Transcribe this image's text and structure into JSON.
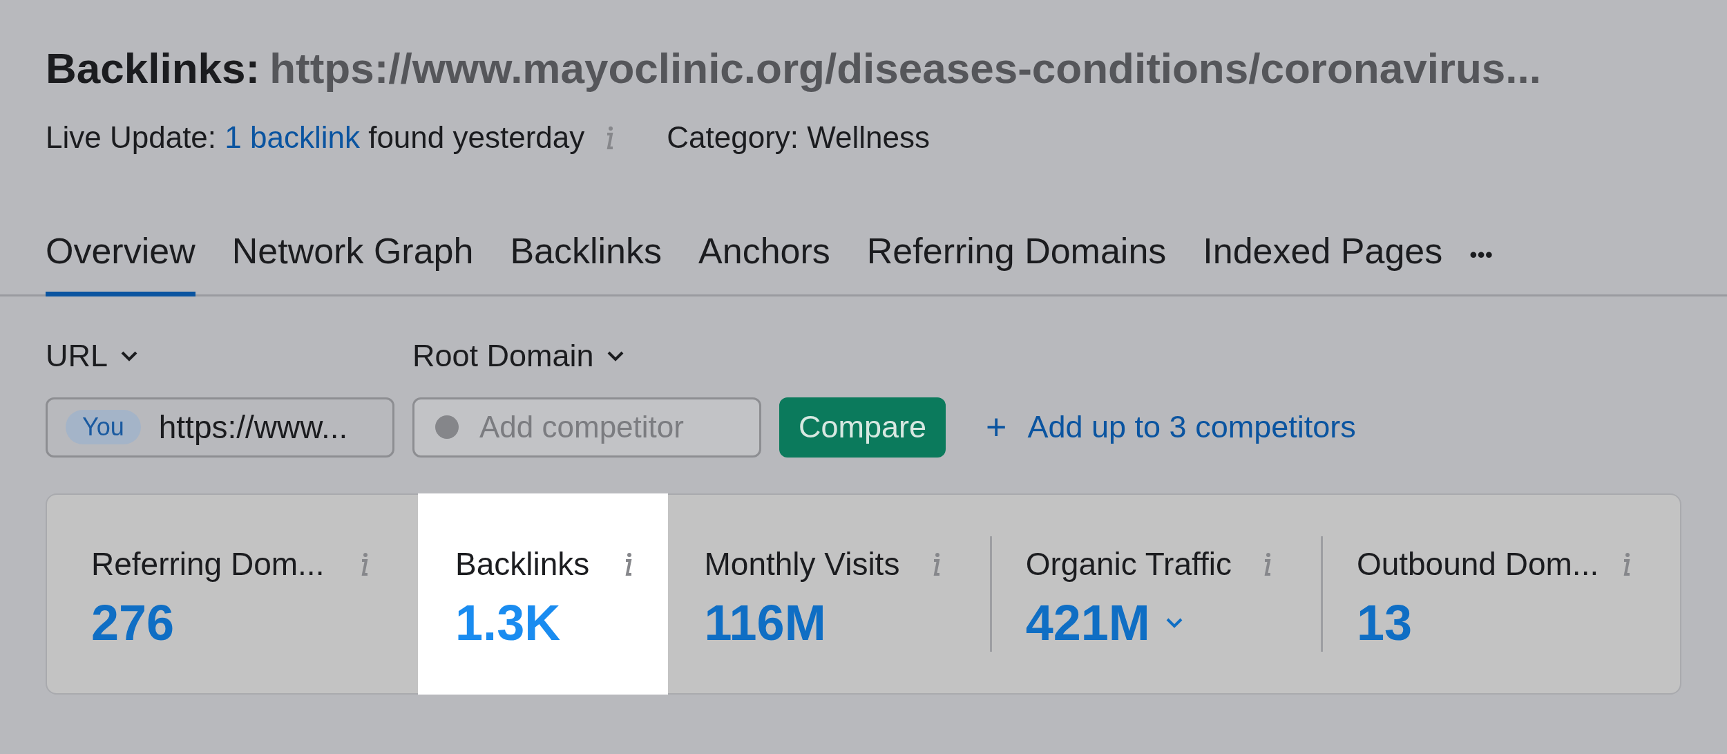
{
  "header": {
    "title_label": "Backlinks:",
    "title_url": "https://www.mayoclinic.org/diseases-conditions/coronavirus...",
    "live_update": {
      "prefix": "Live Update:",
      "link": "1 backlink",
      "suffix": "found yesterday"
    },
    "category": "Category: Wellness"
  },
  "tabs": [
    {
      "label": "Overview",
      "selected": true
    },
    {
      "label": "Network Graph",
      "selected": false
    },
    {
      "label": "Backlinks",
      "selected": false
    },
    {
      "label": "Anchors",
      "selected": false
    },
    {
      "label": "Referring Domains",
      "selected": false
    },
    {
      "label": "Indexed Pages",
      "selected": false
    }
  ],
  "more_tabs": "•••",
  "compare": {
    "target_type": "URL",
    "competitor_type": "Root Domain",
    "you_badge": "You",
    "target_value": "https://www...",
    "competitor_placeholder": "Add competitor",
    "button": "Compare",
    "add_link": "Add up to 3 competitors",
    "add_icon": "+"
  },
  "metrics": [
    {
      "label": "Referring Dom...",
      "value": "276",
      "selected": false,
      "dropdown": false
    },
    {
      "label": "Backlinks",
      "value": "1.3K",
      "selected": true,
      "dropdown": false
    },
    {
      "label": "Monthly Visits",
      "value": "116M",
      "selected": false,
      "dropdown": false
    },
    {
      "label": "Organic Traffic",
      "value": "421M",
      "selected": false,
      "dropdown": true
    },
    {
      "label": "Outbound Dom...",
      "value": "13",
      "selected": false,
      "dropdown": false
    }
  ]
}
